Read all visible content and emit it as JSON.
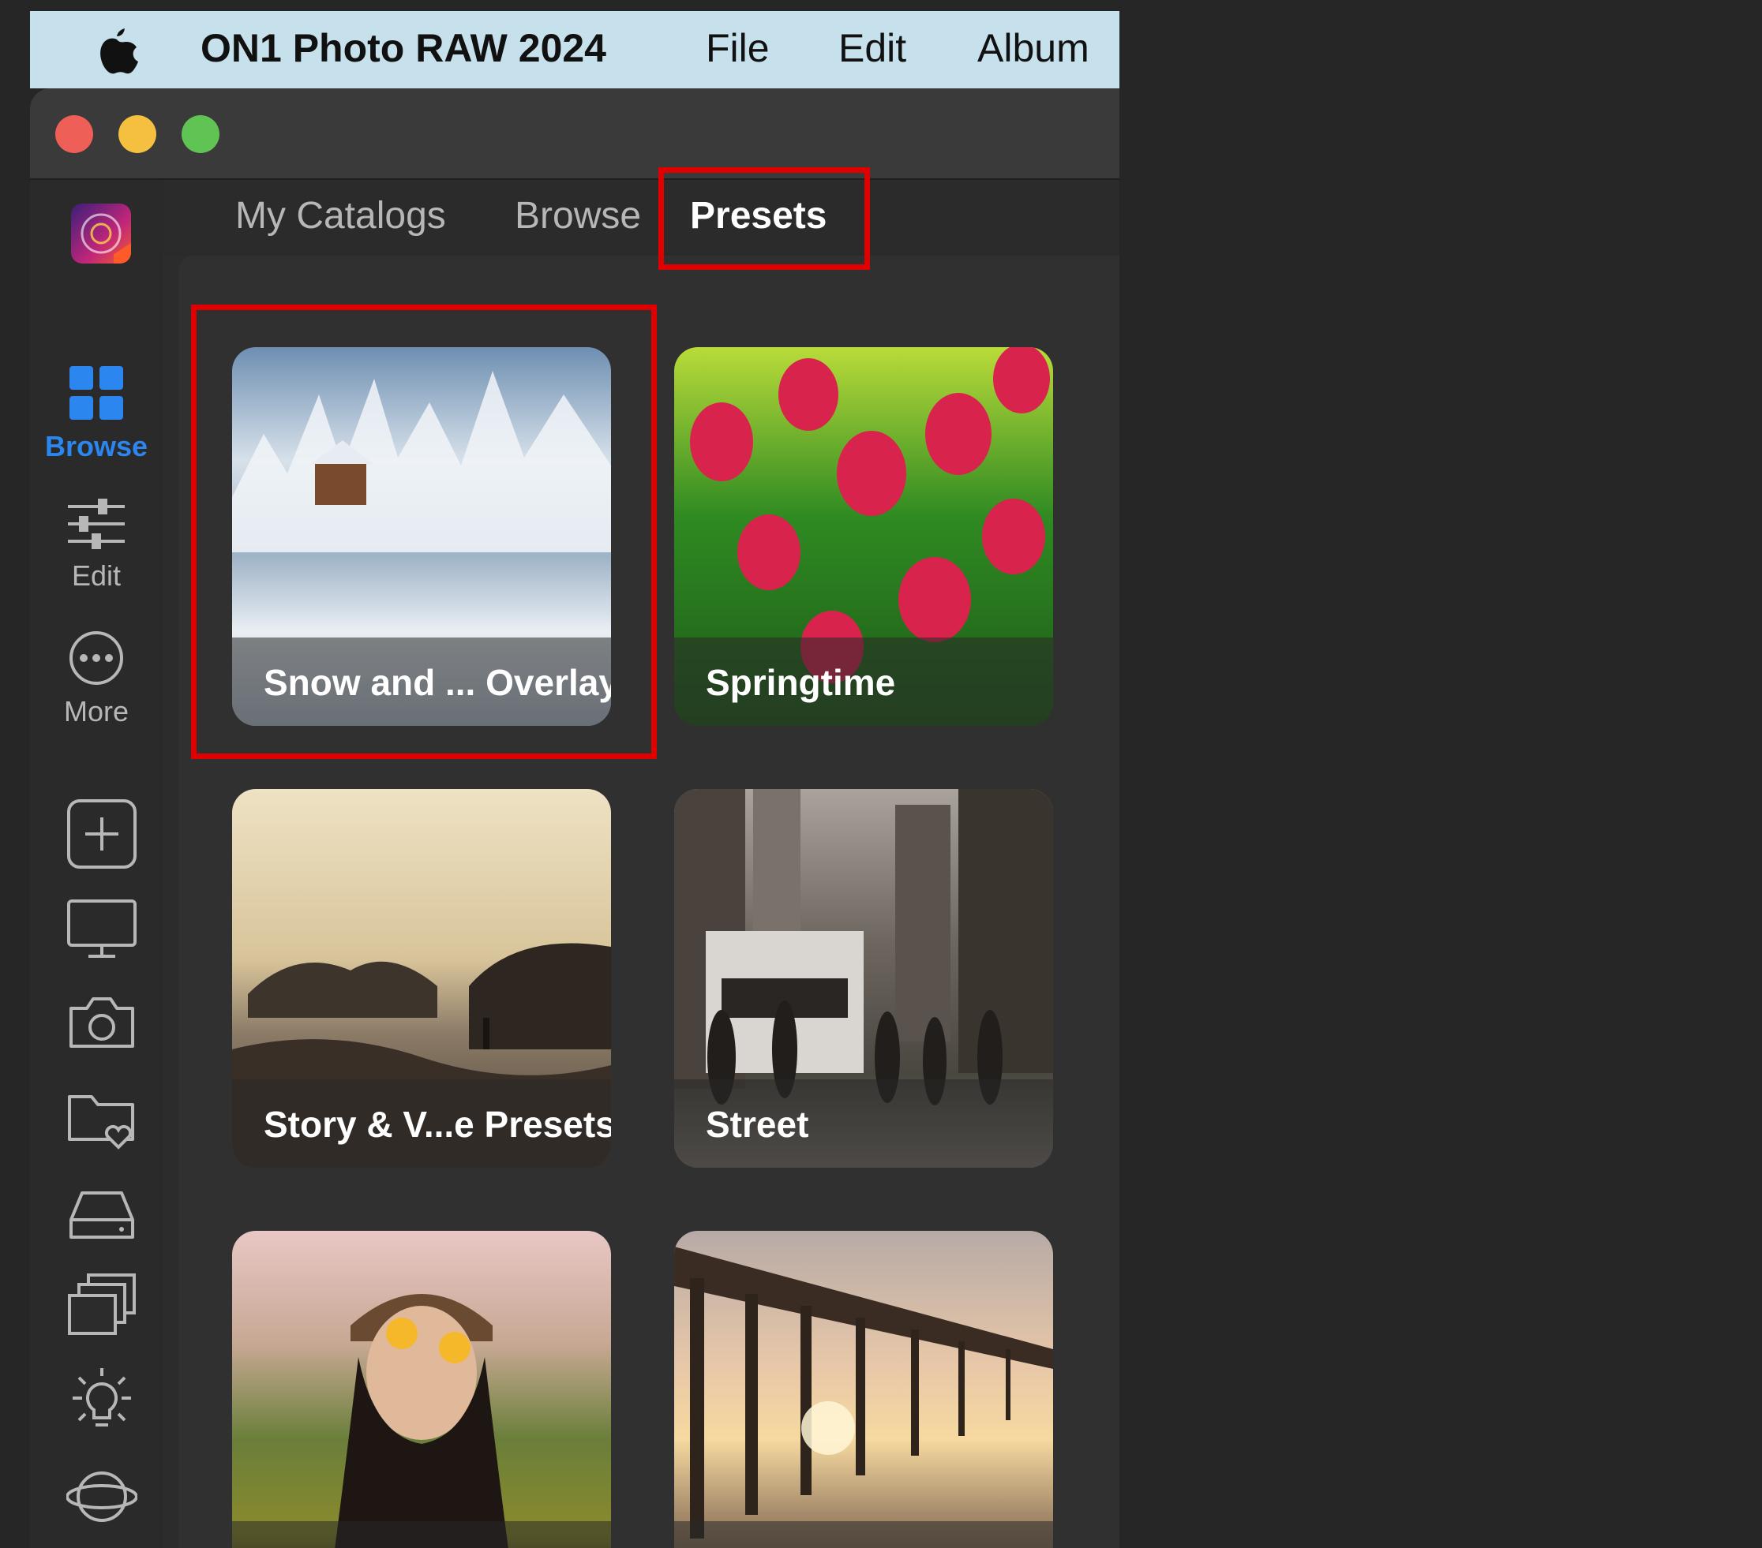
{
  "menubar": {
    "app_name": "ON1 Photo RAW 2024",
    "items": [
      "File",
      "Edit",
      "Album"
    ]
  },
  "tabs": [
    {
      "label": "My Catalogs",
      "active": false
    },
    {
      "label": "Browse",
      "active": false
    },
    {
      "label": "Presets",
      "active": true
    }
  ],
  "sidebar": {
    "items": [
      {
        "label": "Browse",
        "icon": "grid-icon",
        "active": true
      },
      {
        "label": "Edit",
        "icon": "sliders-icon",
        "active": false
      },
      {
        "label": "More",
        "icon": "more-icon",
        "active": false
      }
    ],
    "tools": [
      "add-icon",
      "monitor-icon",
      "camera-icon",
      "folder-heart-icon",
      "drive-icon",
      "stack-icon",
      "lightbulb-icon",
      "orbit-icon"
    ]
  },
  "presets": [
    {
      "label": "Snow and ... Overlays",
      "selected": true
    },
    {
      "label": "Springtime",
      "selected": false
    },
    {
      "label": "Story & V...e Presets",
      "selected": false
    },
    {
      "label": "Street",
      "selected": false
    },
    {
      "label": "",
      "selected": false
    },
    {
      "label": "",
      "selected": false
    }
  ],
  "colors": {
    "accent": "#2b86f0",
    "highlight": "#e00000",
    "menubar": "#c6e1ec"
  }
}
